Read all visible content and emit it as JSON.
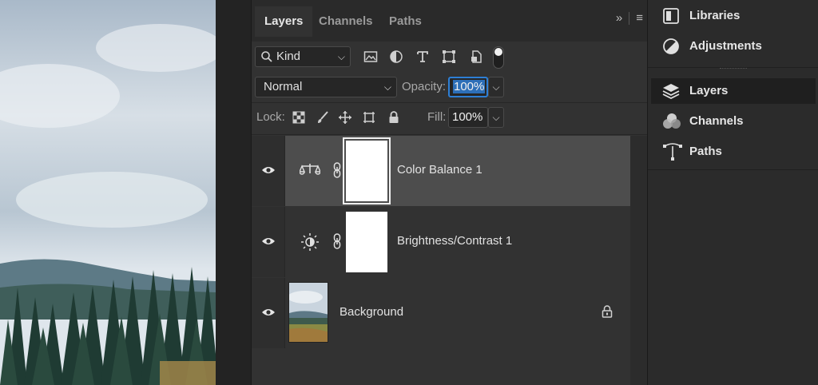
{
  "layers_panel": {
    "tabs": [
      {
        "label": "Layers",
        "active": true
      },
      {
        "label": "Channels",
        "active": false
      },
      {
        "label": "Paths",
        "active": false
      }
    ],
    "collapse_glyph": "»",
    "menu_glyph": "≡",
    "filter": {
      "kind_label": "Kind",
      "icons": [
        "image-filter-icon",
        "adjustment-filter-icon",
        "type-filter-icon",
        "shape-filter-icon",
        "smart-object-filter-icon"
      ]
    },
    "blend_mode": "Normal",
    "opacity_label": "Opacity:",
    "opacity_value": "100%",
    "lock_label": "Lock:",
    "fill_label": "Fill:",
    "fill_value": "100%",
    "layers": [
      {
        "name": "Color Balance 1",
        "type": "adjustment",
        "icon": "color-balance-icon",
        "selected": true,
        "visible": true
      },
      {
        "name": "Brightness/Contrast 1",
        "type": "adjustment",
        "icon": "brightness-contrast-icon",
        "selected": false,
        "visible": true
      },
      {
        "name": "Background",
        "type": "image",
        "locked": true,
        "selected": false,
        "visible": true
      }
    ]
  },
  "dock": {
    "items": [
      {
        "label": "Libraries",
        "icon": "libraries-icon",
        "active": false
      },
      {
        "label": "Adjustments",
        "icon": "adjustments-icon",
        "active": false
      },
      {
        "label": "Layers",
        "icon": "layers-icon",
        "active": true
      },
      {
        "label": "Channels",
        "icon": "channels-icon",
        "active": false
      },
      {
        "label": "Paths",
        "icon": "paths-icon",
        "active": false
      }
    ]
  },
  "colors": {
    "panel_bg": "#323232",
    "selected_row": "#4d4d4d",
    "focus_blue": "#2d7fd6"
  }
}
